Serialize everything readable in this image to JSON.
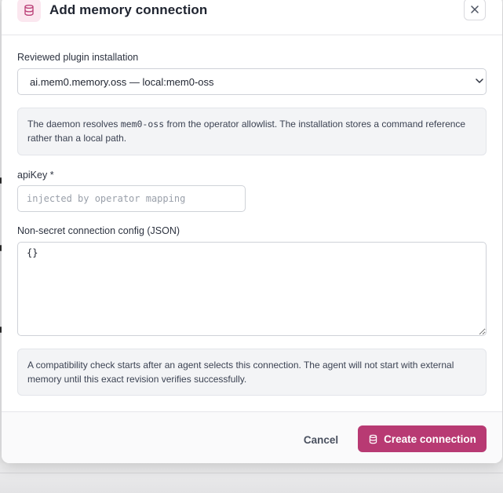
{
  "dialog": {
    "title": "Add memory connection",
    "icon": "database-icon",
    "close_icon": "close-icon"
  },
  "form": {
    "plugin": {
      "label": "Reviewed plugin installation",
      "selected": "ai.mem0.memory.oss — local:mem0-oss"
    },
    "resolve_note": {
      "before": "The daemon resolves ",
      "code": "mem0-oss",
      "after": " from the operator allowlist. The installation stores a command reference rather than a local path."
    },
    "api_key": {
      "label": "apiKey *",
      "value": "",
      "placeholder": "injected by operator mapping"
    },
    "config": {
      "label": "Non-secret connection config (JSON)",
      "value": "{}"
    },
    "compat_note": "A compatibility check starts after an agent selects this connection. The agent will not start with external memory until this exact revision verifies successfully."
  },
  "footer": {
    "cancel_label": "Cancel",
    "create_label": "Create connection",
    "create_icon": "database-icon"
  },
  "colors": {
    "accent": "#b83a73",
    "accent_soft": "#fbe7ef",
    "info_bg": "#f3f4f6"
  }
}
